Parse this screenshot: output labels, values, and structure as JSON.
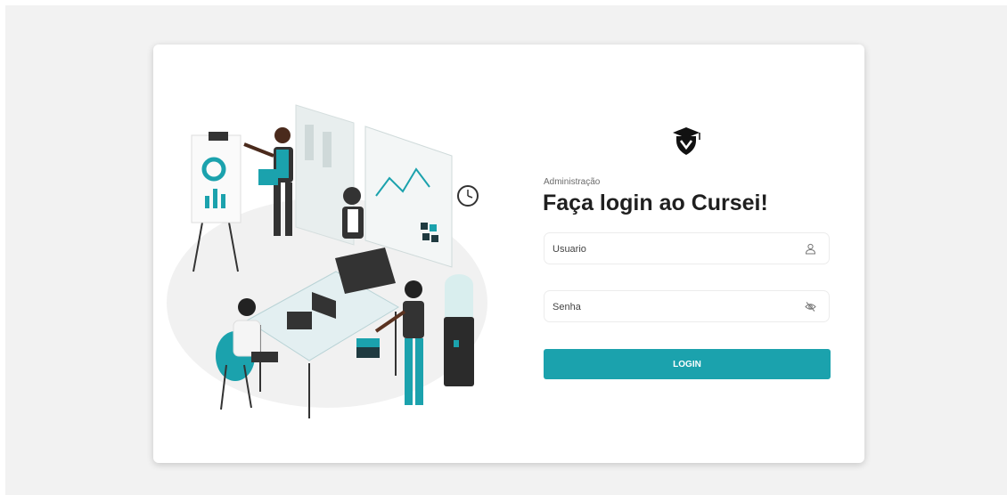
{
  "login": {
    "subtitle": "Administração",
    "title": "Faça login ao Cursei!",
    "username_placeholder": "Usuario",
    "password_placeholder": "Senha",
    "button_label": "LOGIN"
  },
  "icons": {
    "logo": "graduation-cap-shield-icon",
    "username": "user-icon",
    "password": "eye-slash-icon"
  },
  "colors": {
    "accent": "#1ba2ad",
    "page_background": "#f2f2f2",
    "card_background": "#ffffff",
    "title": "#1f1f1f"
  }
}
